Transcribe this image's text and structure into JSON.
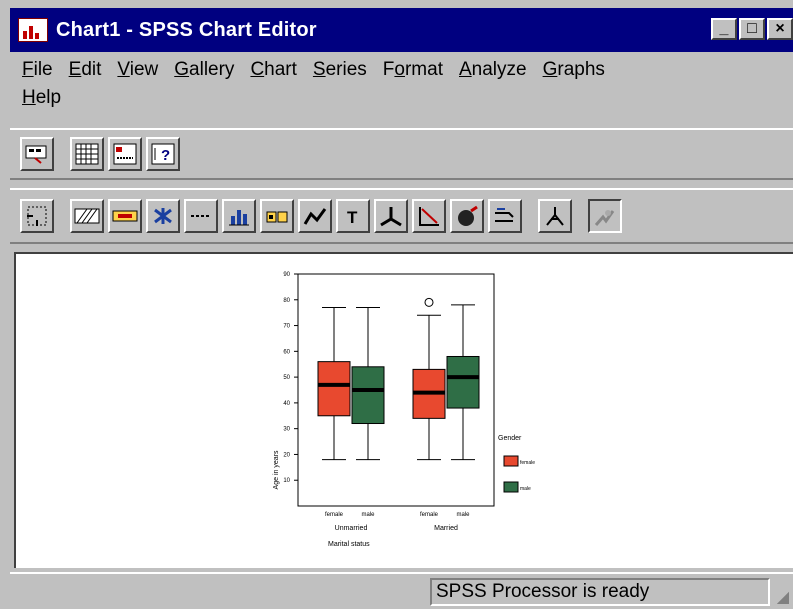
{
  "window": {
    "title": "Chart1 - SPSS Chart Editor",
    "icon": "spss-chart-icon"
  },
  "window_buttons": [
    {
      "name": "minimize-icon",
      "glyph": "_"
    },
    {
      "name": "maximize-icon",
      "glyph": "□"
    },
    {
      "name": "close-icon",
      "glyph": "×"
    }
  ],
  "menu": {
    "row1": [
      {
        "label": "File",
        "hot": "F",
        "rest": "ile"
      },
      {
        "label": "Edit",
        "hot": "E",
        "rest": "dit"
      },
      {
        "label": "View",
        "hot": "V",
        "rest": "iew"
      },
      {
        "label": "Gallery",
        "hot": "G",
        "rest": "allery"
      },
      {
        "label": "Chart",
        "hot": "C",
        "rest": "hart"
      },
      {
        "label": "Series",
        "hot": "S",
        "rest": "eries"
      },
      {
        "label": "Format",
        "pre": "F",
        "hot": "o",
        "rest": "rmat"
      },
      {
        "label": "Analyze",
        "hot": "A",
        "rest": "nalyze"
      },
      {
        "label": "Graphs",
        "hot": "G",
        "rest": "raphs"
      }
    ],
    "row2": [
      {
        "label": "Help",
        "hot": "H",
        "rest": "elp"
      }
    ]
  },
  "toolbar1": [
    "data-editor-icon",
    "grid-icon",
    "legend-icon",
    "help-icon"
  ],
  "toolbar2": [
    "select-icon",
    "fill-pattern-icon",
    "color-icon",
    "marker-icon",
    "line-style-icon",
    "bar-style-icon",
    "label-icon",
    "interpolation-icon",
    "text-icon",
    "axis-icon",
    "reference-line-icon",
    "rotate-3d-icon",
    "swap-axes-icon",
    "spin-icon",
    "explode-icon"
  ],
  "chart_data": {
    "type": "boxplot",
    "ylabel": "Age in years",
    "xlabel": "Marital status",
    "legend_title": "Gender",
    "legend": [
      {
        "label": "female",
        "color": "#e8492f"
      },
      {
        "label": "male",
        "color": "#2f6e46"
      }
    ],
    "ylim": [
      0,
      90
    ],
    "yticks": [
      10,
      20,
      30,
      40,
      50,
      60,
      70,
      80,
      90
    ],
    "groups": [
      {
        "label": "Unmarried",
        "boxes": [
          {
            "series": "female",
            "min": 18,
            "q1": 35,
            "median": 47,
            "q3": 56,
            "max": 77
          },
          {
            "series": "male",
            "min": 18,
            "q1": 32,
            "median": 45,
            "q3": 54,
            "max": 77
          }
        ]
      },
      {
        "label": "Married",
        "boxes": [
          {
            "series": "female",
            "min": 18,
            "q1": 34,
            "median": 44,
            "q3": 53,
            "max": 74,
            "outlier": 79
          },
          {
            "series": "male",
            "min": 18,
            "q1": 38,
            "median": 50,
            "q3": 58,
            "max": 78
          }
        ]
      }
    ]
  },
  "status": {
    "text": "SPSS Processor is ready"
  }
}
